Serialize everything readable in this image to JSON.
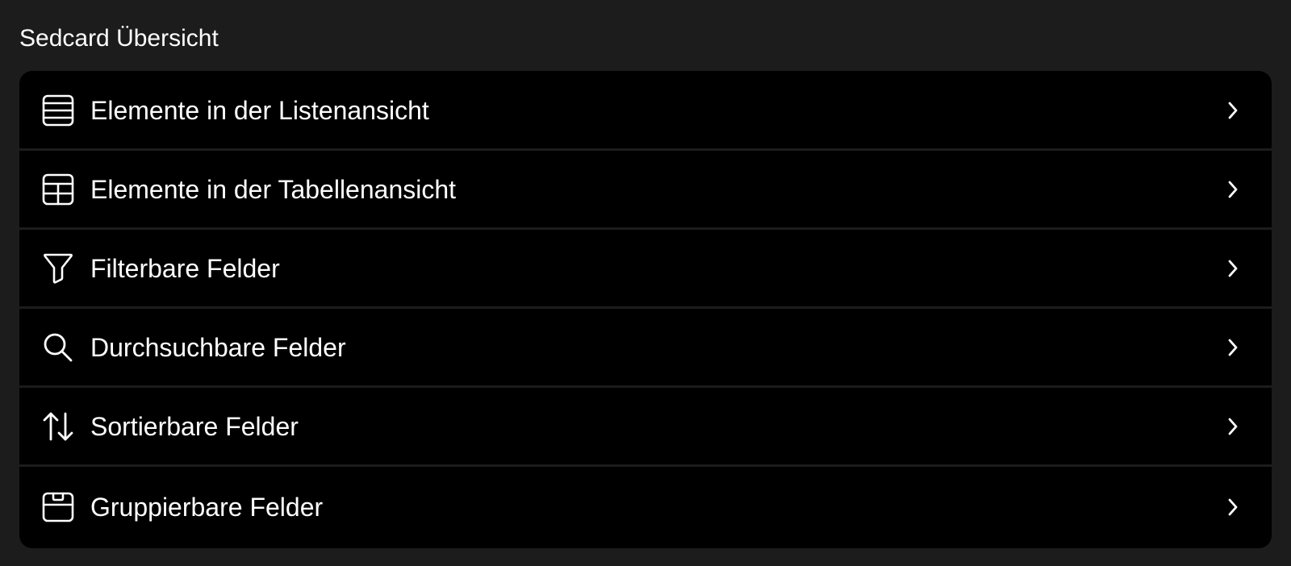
{
  "section": {
    "title": "Sedcard Übersicht"
  },
  "items": [
    {
      "label": "Elemente in der Listenansicht",
      "icon": "list-view-icon"
    },
    {
      "label": "Elemente in der Tabellenansicht",
      "icon": "table-view-icon"
    },
    {
      "label": "Filterbare Felder",
      "icon": "filter-icon"
    },
    {
      "label": "Durchsuchbare Felder",
      "icon": "search-icon"
    },
    {
      "label": "Sortierbare Felder",
      "icon": "sort-icon"
    },
    {
      "label": "Gruppierbare Felder",
      "icon": "tray-icon"
    }
  ],
  "colors": {
    "background": "#1c1c1c",
    "list_background": "#000000",
    "text": "#ffffff"
  }
}
